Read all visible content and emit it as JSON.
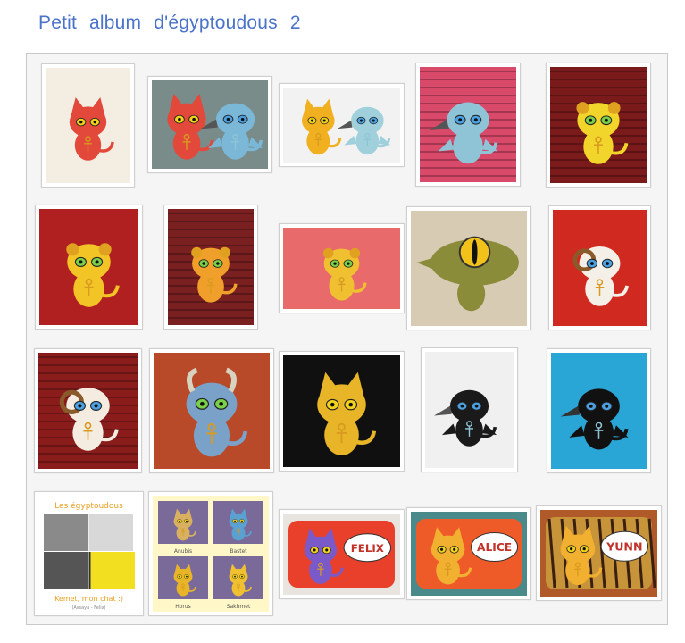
{
  "page": {
    "title": "Petit album d'égyptoudous 2"
  },
  "colors": {
    "title": "#4a73c9",
    "album_bg": "#f5f5f5",
    "album_border": "#c9c9c9"
  },
  "thumbnails": [
    {
      "subject": "red cat plush with ankh",
      "kind": "cat",
      "bg": "#f3ede2",
      "body": "#e2493a"
    },
    {
      "subject": "red cat and blue bird plush",
      "kind": "pair",
      "bg": "#7a8c8a",
      "body": "#e2493a",
      "body2": "#7bb8d8"
    },
    {
      "subject": "yellow cat and blue bird keychains",
      "kind": "pair",
      "bg": "#f2f2f2",
      "body": "#f0b020",
      "body2": "#9fd0dc"
    },
    {
      "subject": "blue bird plush on striped cloth",
      "kind": "bird",
      "bg": "#d94a6a",
      "body": "#8ec4d6"
    },
    {
      "subject": "yellow lion plush",
      "kind": "lion",
      "bg": "#7a1a1a",
      "body": "#f2d52a"
    },
    {
      "subject": "yellow lion plush",
      "kind": "lion",
      "bg": "#b02020",
      "body": "#f2c426"
    },
    {
      "subject": "orange lion keychain",
      "kind": "lion",
      "bg": "#7a2020",
      "body": "#f0a02a"
    },
    {
      "subject": "lion keychain with cards",
      "kind": "lion",
      "bg": "#e86a6a",
      "body": "#f0c030"
    },
    {
      "subject": "green crocodile plush",
      "kind": "croc",
      "bg": "#d8cbb4",
      "body": "#8a8c3a"
    },
    {
      "subject": "white ram plush",
      "kind": "ram",
      "bg": "#d02a20",
      "body": "#f4f0e8"
    },
    {
      "subject": "white ram plush on red cloth",
      "kind": "ram",
      "bg": "#8a1c1c",
      "body": "#f4ece0"
    },
    {
      "subject": "blue cow plush",
      "kind": "cow",
      "bg": "#b84a2a",
      "body": "#7aa2c8"
    },
    {
      "subject": "yellow cat with sun disk",
      "kind": "cat",
      "bg": "#101010",
      "body": "#e8b428"
    },
    {
      "subject": "black bird plush",
      "kind": "bird",
      "bg": "#f0f0f0",
      "body": "#1a1a1a"
    },
    {
      "subject": "black ibis keychain",
      "kind": "ibis",
      "bg": "#2aa6d6",
      "body": "#111111"
    },
    {
      "subject": "Les égyptoudous photo collage",
      "kind": "collage1",
      "bg": "#ffffff",
      "title": "Les égyptoudous",
      "caption": "Kemet, mon chat :)",
      "sub": "(Assaya - Felix)"
    },
    {
      "subject": "character collage",
      "kind": "collage2",
      "bg": "#fff7c8",
      "names": [
        "Anubis",
        "Bastet",
        "Horus",
        "Sakhmet"
      ]
    },
    {
      "subject": "red pouch Felix",
      "kind": "pouch",
      "bg": "#e8e4df",
      "body": "#e8402a",
      "bubble": "FELIX"
    },
    {
      "subject": "red pouch Alice",
      "kind": "pouch",
      "bg": "#4a8a8a",
      "body": "#ee5a28",
      "bubble": "ALICE"
    },
    {
      "subject": "tiger stripe pouch Yunn",
      "kind": "pouch",
      "bg": "#b05a2a",
      "body": "#c8943a",
      "bubble": "YUNN"
    }
  ]
}
